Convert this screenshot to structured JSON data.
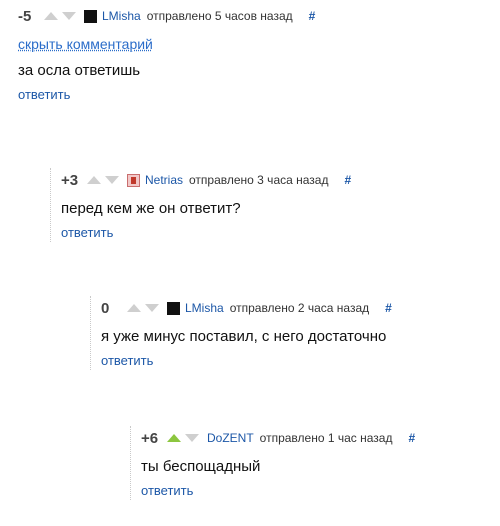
{
  "comments": [
    {
      "score": "-5",
      "username": "LMisha",
      "time": "отправлено 5 часов назад",
      "hash": "#",
      "hide_label": "скрыть комментарий",
      "text": "за осла ответишь",
      "reply": "ответить",
      "avatar": "black-square-icon"
    },
    {
      "score": "+3",
      "username": "Netrias",
      "time": "отправлено 3 часа назад",
      "hash": "#",
      "text": "перед кем же он ответит?",
      "reply": "ответить",
      "avatar": "user-avatar-icon"
    },
    {
      "score": "0",
      "username": "LMisha",
      "time": "отправлено 2 часа назад",
      "hash": "#",
      "text": "я уже минус поставил, с него достаточно",
      "reply": "ответить",
      "avatar": "black-square-icon"
    },
    {
      "score": "+6",
      "username": "DoZENT",
      "time": "отправлено 1 час назад",
      "hash": "#",
      "text": "ты беспощадный",
      "reply": "ответить",
      "upvoted": true
    }
  ],
  "colors": {
    "link": "#1c57a7",
    "upvote_active": "#8cc63f",
    "vote_inactive": "#cfcfcf"
  }
}
